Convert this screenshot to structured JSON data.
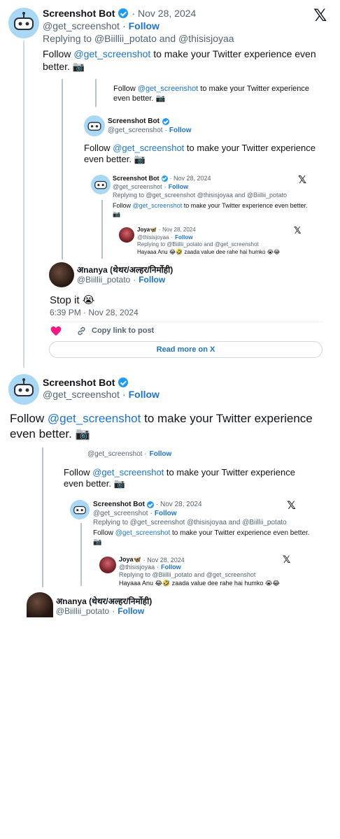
{
  "main_tweet": {
    "author_name": "Screenshot Bot",
    "date": "· Nov 28, 2024",
    "handle": "@get_screenshot",
    "follow": "Follow",
    "replying": "Replying to @Biillii_potato and @thisisjoyaa",
    "text_prefix": "Follow",
    "text_link": "@get_screenshot",
    "text_suffix": "to make your Twitter experience even better. 📷"
  },
  "embedded_1": {
    "top_text_prefix": "Follow",
    "top_text_link": "@get_screenshot",
    "top_text_suffix": "to make your Twitter experience even better. 📷",
    "bot_name": "Screenshot Bot",
    "bot_handle": "@get_screenshot",
    "follow": "Follow",
    "bot_text_prefix": "Follow",
    "bot_text_link": "@get_screenshot",
    "bot_text_suffix": "to make your Twitter experience even better. 📷",
    "inner_name": "Screenshot Bot",
    "inner_date": "· Nov 28, 2024",
    "inner_handle": "@get_screenshot",
    "inner_replying": "Replying to @get_screenshot @thisisjoyaa and @Biillii_potato",
    "inner_text_prefix": "Follow",
    "inner_text_link": "@get_screenshot",
    "inner_text_suffix": "to make your Twitter experience even better. 📷",
    "joya_name": "Joya🦋",
    "joya_date": "· Nov 28, 2024",
    "joya_handle": "@thisisjoyaa",
    "joya_replying": "Replying to @Biillii_potato and @get_screenshot",
    "joya_text": "Hayaaa Anu 😂🤣 zaada value dee rahe hai humko 😭😂"
  },
  "reply_tweet": {
    "author_name": "अnanya (थेथर/अल्हर/निर्मोही)",
    "handle": "@Biillii_potato",
    "follow": "Follow",
    "text": "Stop it 😭",
    "timestamp": "6:39 PM · Nov 28, 2024",
    "like_icon": "heart-icon",
    "copy_link": "Copy link to post",
    "read_more": "Read more on X"
  },
  "second_tweet": {
    "author_name": "Screenshot Bot",
    "handle": "@get_screenshot",
    "follow": "Follow",
    "text_prefix": "Follow",
    "text_link": "@get_screenshot",
    "text_suffix": "to make your Twitter experience even better. 📷"
  },
  "embedded_2": {
    "top_handle": "@get_screenshot ·",
    "top_follow": "Follow",
    "text_prefix": "Follow",
    "text_link": "@get_screenshot",
    "text_suffix": "to make your Twitter experience even better. 📷",
    "inner_name": "Screenshot Bot",
    "inner_date": "· Nov 28, 2024",
    "inner_handle": "@get_screenshot",
    "follow": "Follow",
    "inner_replying": "Replying to @get_screenshot @thisisjoyaa and @Biillii_potato",
    "inner_text_prefix": "Follow",
    "inner_text_link": "@get_screenshot",
    "inner_text_suffix": "to make your Twitter experience even better. 📷",
    "joya_name": "Joya🦋",
    "joya_date": "· Nov 28, 2024",
    "joya_handle": "@thisisjoyaa",
    "joya_replying": "Replying to @Biillii_potato and @get_screenshot",
    "joya_text": "Hayaaa Anu 😂🤣 zaada value dee rahe hai humko 😭😂"
  },
  "bottom_reply": {
    "author_name": "अnanya (थेथर/अल्हर/निर्मोही)",
    "handle": "@Biillii_potato",
    "follow": "Follow"
  },
  "x_logo": "𝕏",
  "colors": {
    "accent": "#1d9bf0",
    "link": "#1d74c9",
    "heart": "#f91880"
  }
}
